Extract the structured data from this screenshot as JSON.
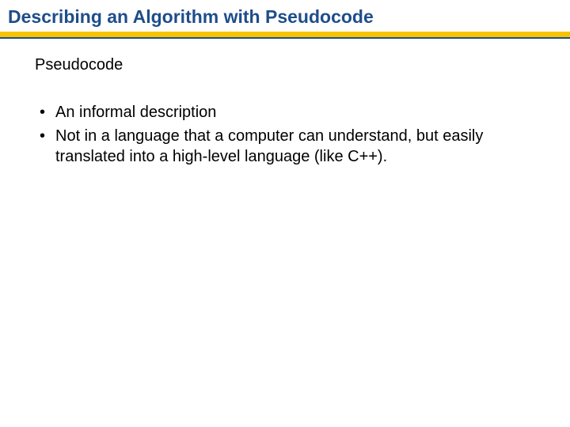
{
  "title": "Describing an Algorithm with Pseudocode",
  "subheading": "Pseudocode",
  "bullets": [
    "An informal description",
    "Not in a language that a computer can understand, but easily translated into a high-level language (like C++)."
  ]
}
